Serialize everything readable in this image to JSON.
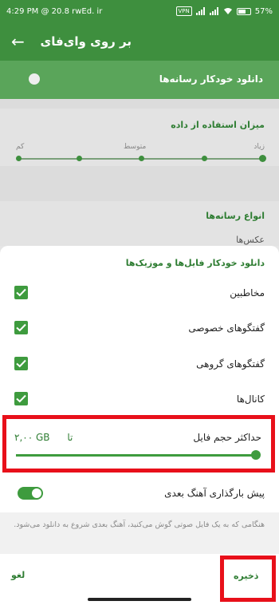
{
  "status_bar": {
    "time": "4:29 PM",
    "left_text": "@ 20.8 rwEd. ir",
    "vpn_label": "VPN",
    "battery": "57%"
  },
  "app_bar": {
    "title": "بر روی وای‌فای"
  },
  "background": {
    "auto_download_label": "دانلود خودکار رسانه‌ها",
    "usage_title": "میزان استفاده از داده",
    "usage_levels": {
      "low": "کم",
      "medium": "متوسط",
      "high": "زیاد"
    },
    "media_types_title": "انواع رسانه‌ها",
    "media_types_first_item": "عکس‌ها"
  },
  "dialog": {
    "title": "دانلود خودکار فایل‌ها و موزیک‌ها",
    "checkboxes": [
      {
        "label": "مخاطبین",
        "checked": true
      },
      {
        "label": "گفتگوهای خصوصی",
        "checked": true
      },
      {
        "label": "گفتگوهای گروهی",
        "checked": true
      },
      {
        "label": "کانال‌ها",
        "checked": true
      }
    ],
    "max_file_size": {
      "label": "حداکثر حجم فایل",
      "value_prefix": "تا",
      "value": "۲,۰۰ GB",
      "slider_fraction": 1.0
    },
    "preload": {
      "label": "پیش بارگذاری آهنگ بعدی",
      "enabled": true
    },
    "info_text": "هنگامی که به یک فایل صوتی گوش می‌کنید، آهنگ بعدی شروع به دانلود می‌شود.",
    "cancel_label": "لغو",
    "save_label": "ذخیره"
  },
  "colors": {
    "primary": "#3e8f3e",
    "accent_text": "#2e7d32",
    "highlight": "#e8101a"
  }
}
